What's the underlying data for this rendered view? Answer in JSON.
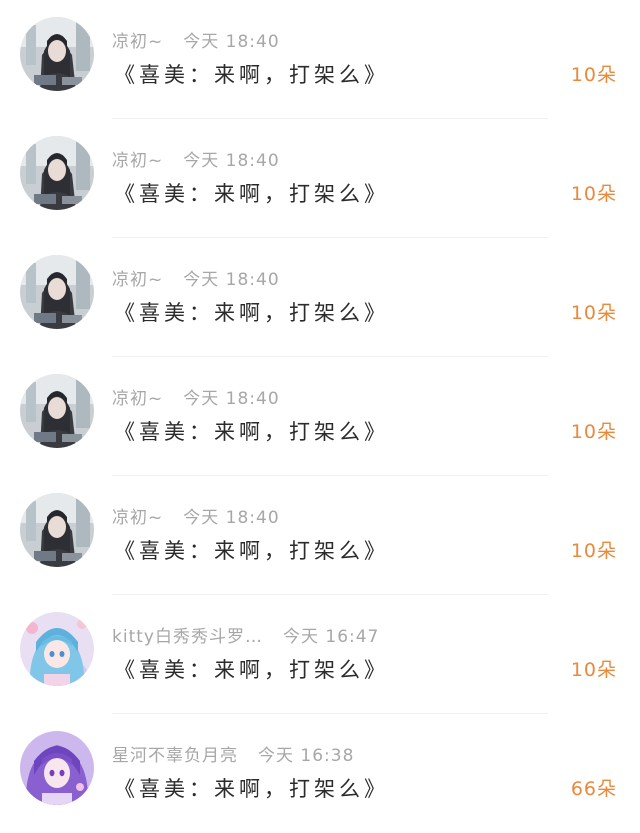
{
  "gift_list": {
    "items": [
      {
        "avatar": "anime-girl-dark-avatar",
        "name": "凉初~",
        "time": "今天 18:40",
        "gift": "《喜美：来啊，打架么》",
        "count": "10朵"
      },
      {
        "avatar": "anime-girl-dark-avatar",
        "name": "凉初~",
        "time": "今天 18:40",
        "gift": "《喜美：来啊，打架么》",
        "count": "10朵"
      },
      {
        "avatar": "anime-girl-dark-avatar",
        "name": "凉初~",
        "time": "今天 18:40",
        "gift": "《喜美：来啊，打架么》",
        "count": "10朵"
      },
      {
        "avatar": "anime-girl-dark-avatar",
        "name": "凉初~",
        "time": "今天 18:40",
        "gift": "《喜美：来啊，打架么》",
        "count": "10朵"
      },
      {
        "avatar": "anime-girl-dark-avatar",
        "name": "凉初~",
        "time": "今天 18:40",
        "gift": "《喜美：来啊，打架么》",
        "count": "10朵"
      },
      {
        "avatar": "anime-girl-blue-hair-avatar",
        "name": "kitty白秀秀斗罗…",
        "time": "今天 16:47",
        "gift": "《喜美：来啊，打架么》",
        "count": "10朵"
      },
      {
        "avatar": "anime-girl-purple-hair-avatar",
        "name": "星河不辜负月亮",
        "time": "今天 16:38",
        "gift": "《喜美：来啊，打架么》",
        "count": "66朵"
      }
    ]
  },
  "colors": {
    "meta_text": "#a7a7a7",
    "gift_text": "#2b2b2b",
    "count_text": "#e88a3c",
    "divider": "#f1f1f1"
  }
}
